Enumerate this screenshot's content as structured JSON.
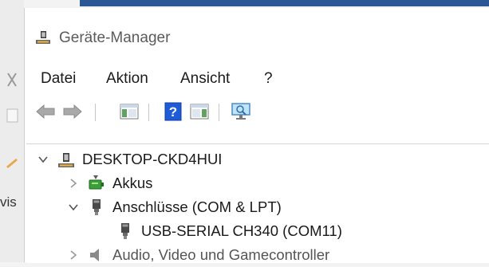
{
  "window": {
    "title": "Geräte-Manager"
  },
  "menu": [
    "Datei",
    "Aktion",
    "Ansicht",
    "?"
  ],
  "toolbar": {
    "buttons": [
      "back-icon",
      "forward-icon",
      "show-hide-console-tree-icon",
      "help-icon",
      "action-pane-icon",
      "scan-hardware-icon"
    ]
  },
  "tree": {
    "root": "DESKTOP-CKD4HUI",
    "items": [
      {
        "label": "Akkus",
        "expanded": false
      },
      {
        "label": "Anschlüsse (COM & LPT)",
        "expanded": true
      },
      {
        "label": "USB-SERIAL CH340 (COM11)"
      },
      {
        "label": "Audio, Video und Gamecontroller"
      }
    ]
  },
  "background_window": {
    "partial_text": "vis"
  },
  "colors": {
    "accent_blue": "#2b5797",
    "help_blue": "#1e5bd6"
  }
}
